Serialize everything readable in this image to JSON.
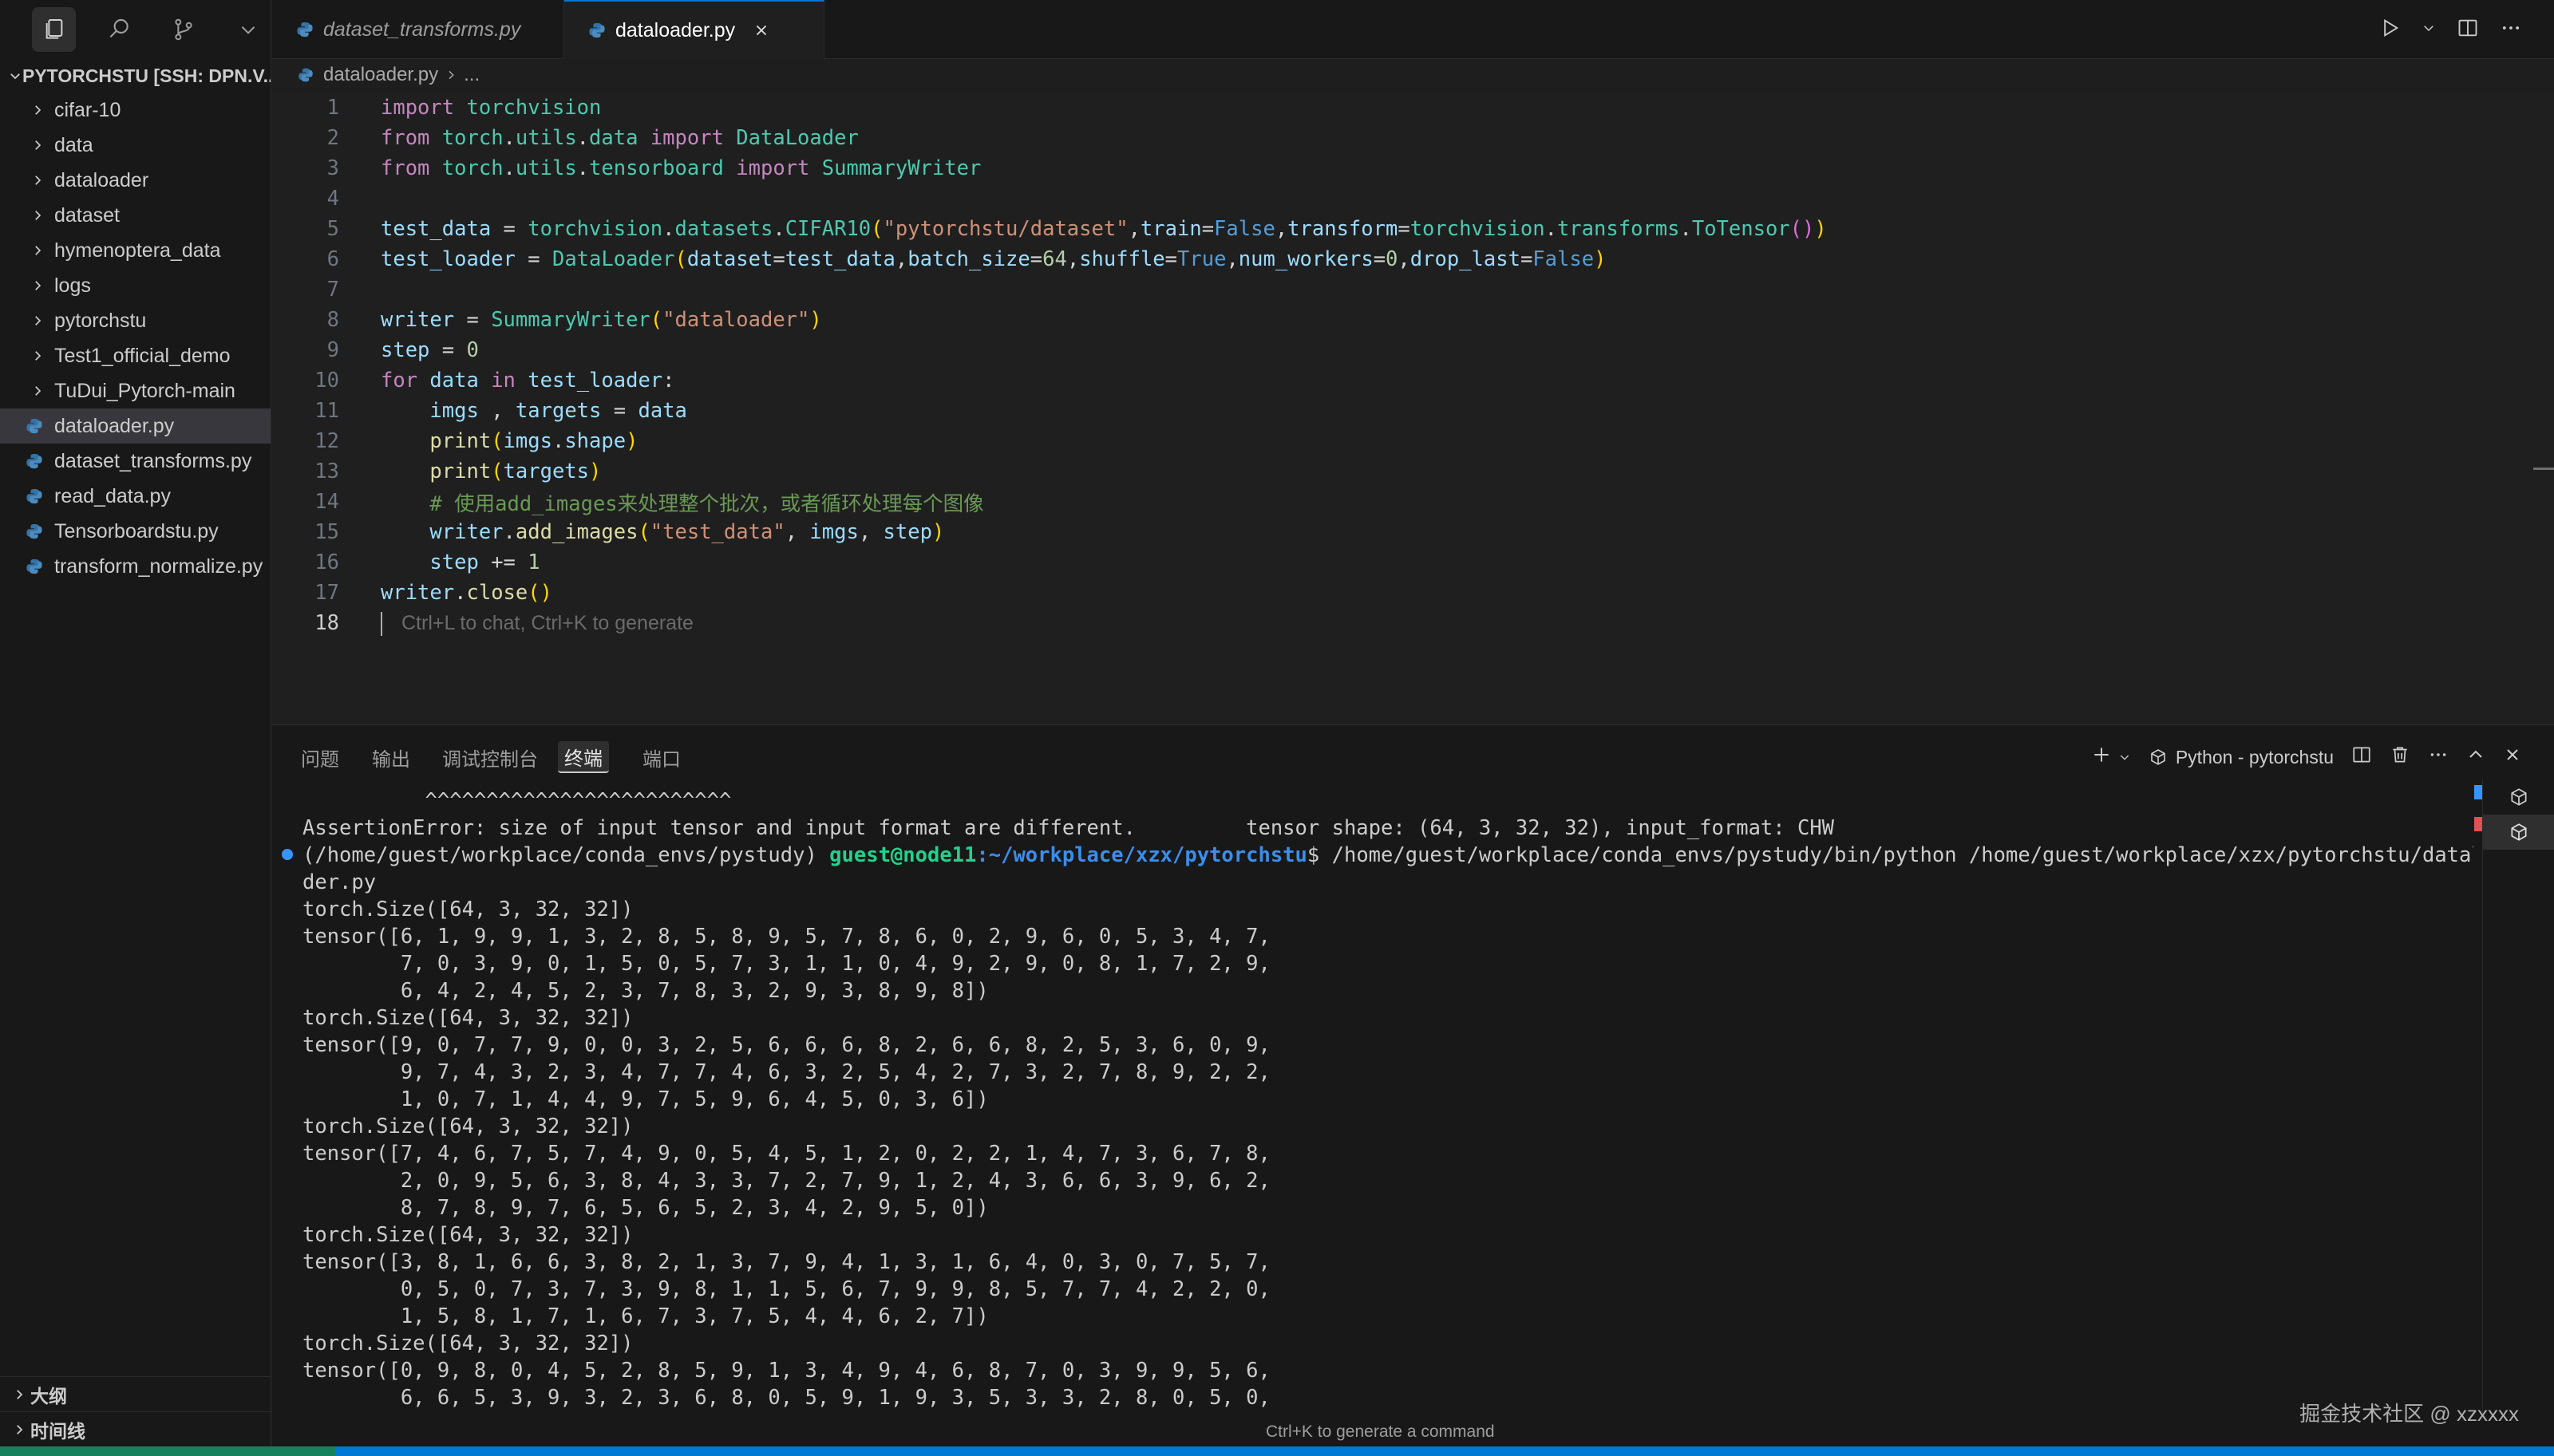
{
  "sidebar": {
    "explorer_title": "PYTORCHSTU [SSH: DPN.V...",
    "folders": [
      "cifar-10",
      "data",
      "dataloader",
      "dataset",
      "hymenoptera_data",
      "logs",
      "pytorchstu",
      "Test1_official_demo",
      "TuDui_Pytorch-main"
    ],
    "files": [
      "dataloader.py",
      "dataset_transforms.py",
      "read_data.py",
      "Tensorboardstu.py",
      "transform_normalize.py"
    ],
    "selected_file": "dataloader.py",
    "outline_label": "大纲",
    "timeline_label": "时间线"
  },
  "tabs": {
    "inactive": "dataset_transforms.py",
    "active": "dataloader.py"
  },
  "breadcrumb": {
    "file": "dataloader.py",
    "rest": "..."
  },
  "editor": {
    "line_numbers": [
      "1",
      "2",
      "3",
      "4",
      "5",
      "6",
      "7",
      "8",
      "9",
      "10",
      "11",
      "12",
      "13",
      "14",
      "15",
      "16",
      "17",
      "18"
    ],
    "current_line": "18",
    "inline_hint": "Ctrl+L to chat, Ctrl+K to generate"
  },
  "panel": {
    "tabs": [
      "问题",
      "输出",
      "调试控制台",
      "终端",
      "端口"
    ],
    "active_tab": "终端",
    "terminal_name": "Python - pytorchstu"
  },
  "terminal": {
    "carets": "          ^^^^^^^^^^^^^^^^^^^^^^^^^",
    "error": "AssertionError: size of input tensor and input format are different.         tensor shape: (64, 3, 32, 32), input_format: CHW",
    "prompt_env": "(/home/guest/workplace/conda_envs/pystudy) ",
    "prompt_user": "guest@node11",
    "prompt_path": ":~/workplace/xzx/pytorchstu",
    "prompt_cmd": "$ /home/guest/workplace/conda_envs/pystudy/bin/python /home/guest/workplace/xzx/pytorchstu/dataloa",
    "wrap": "der.py",
    "lines": [
      "torch.Size([64, 3, 32, 32])",
      "tensor([6, 1, 9, 9, 1, 3, 2, 8, 5, 8, 9, 5, 7, 8, 6, 0, 2, 9, 6, 0, 5, 3, 4, 7,",
      "        7, 0, 3, 9, 0, 1, 5, 0, 5, 7, 3, 1, 1, 0, 4, 9, 2, 9, 0, 8, 1, 7, 2, 9,",
      "        6, 4, 2, 4, 5, 2, 3, 7, 8, 3, 2, 9, 3, 8, 9, 8])",
      "torch.Size([64, 3, 32, 32])",
      "tensor([9, 0, 7, 7, 9, 0, 0, 3, 2, 5, 6, 6, 6, 8, 2, 6, 6, 8, 2, 5, 3, 6, 0, 9,",
      "        9, 7, 4, 3, 2, 3, 4, 7, 7, 4, 6, 3, 2, 5, 4, 2, 7, 3, 2, 7, 8, 9, 2, 2,",
      "        1, 0, 7, 1, 4, 4, 9, 7, 5, 9, 6, 4, 5, 0, 3, 6])",
      "torch.Size([64, 3, 32, 32])",
      "tensor([7, 4, 6, 7, 5, 7, 4, 9, 0, 5, 4, 5, 1, 2, 0, 2, 2, 1, 4, 7, 3, 6, 7, 8,",
      "        2, 0, 9, 5, 6, 3, 8, 4, 3, 3, 7, 2, 7, 9, 1, 2, 4, 3, 6, 6, 3, 9, 6, 2,",
      "        8, 7, 8, 9, 7, 6, 5, 6, 5, 2, 3, 4, 2, 9, 5, 0])",
      "torch.Size([64, 3, 32, 32])",
      "tensor([3, 8, 1, 6, 6, 3, 8, 2, 1, 3, 7, 9, 4, 1, 3, 1, 6, 4, 0, 3, 0, 7, 5, 7,",
      "        0, 5, 0, 7, 3, 7, 3, 9, 8, 1, 1, 5, 6, 7, 9, 9, 8, 5, 7, 7, 4, 2, 2, 0,",
      "        1, 5, 8, 1, 7, 1, 6, 7, 3, 7, 5, 4, 4, 6, 2, 7])",
      "torch.Size([64, 3, 32, 32])",
      "tensor([0, 9, 8, 0, 4, 5, 2, 8, 5, 9, 1, 3, 4, 9, 4, 6, 8, 7, 0, 3, 9, 9, 5, 6,",
      "        6, 6, 5, 3, 9, 3, 2, 3, 6, 8, 0, 5, 9, 1, 9, 3, 5, 3, 3, 2, 8, 0, 5, 0,"
    ]
  },
  "status": {
    "command_hint": "Ctrl+K to generate a command",
    "watermark": "掘金技术社区 @ xzxxxx"
  },
  "colors": {
    "accent": "#0078d4",
    "remote_indicator": "#16825d",
    "terminal_user": "#23d18b",
    "terminal_path": "#3b8eea"
  }
}
